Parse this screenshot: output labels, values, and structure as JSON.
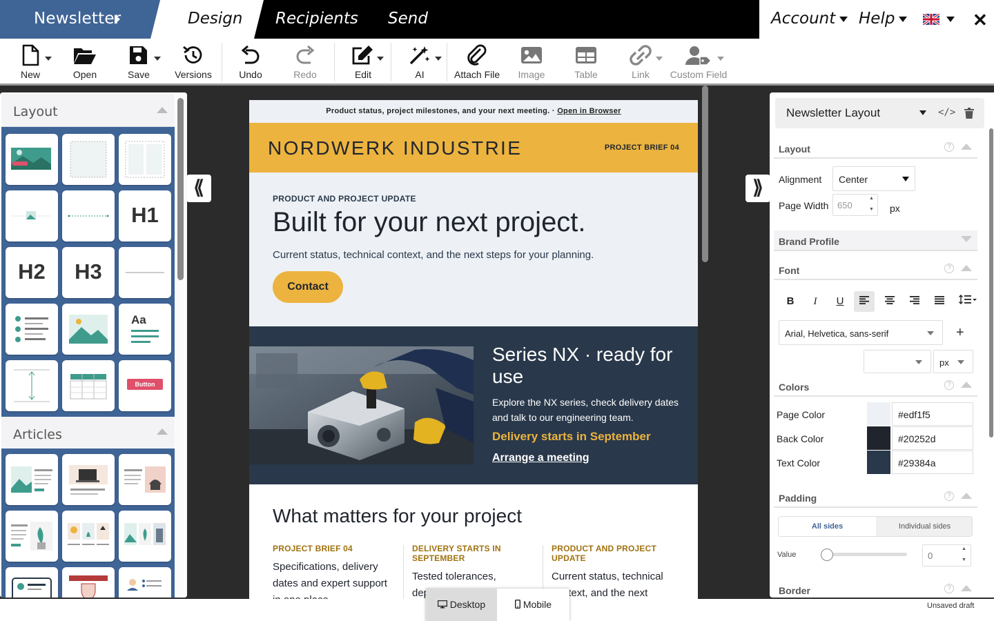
{
  "nav": {
    "brand": "Newsletter",
    "tabs": [
      "Design",
      "Recipients",
      "Send"
    ],
    "account": "Account",
    "help": "Help"
  },
  "toolbar": {
    "new": "New",
    "open": "Open",
    "save": "Save",
    "versions": "Versions",
    "undo": "Undo",
    "redo": "Redo",
    "edit": "Edit",
    "ai": "AI",
    "attach": "Attach File",
    "image": "Image",
    "table": "Table",
    "link": "Link",
    "custom_field": "Custom Field"
  },
  "left_panel": {
    "layout_title": "Layout",
    "articles_title": "Articles",
    "tiles": {
      "h1": "H1",
      "h2": "H2",
      "h3": "H3",
      "aa": "Aa",
      "button": "Button"
    }
  },
  "email": {
    "preheader": "Product status, project milestones, and your next meeting. · ",
    "preheader_link": "Open in Browser",
    "logo": "NORDWERK INDUSTRIE",
    "brief": "PROJECT BRIEF 04",
    "kicker": "PRODUCT AND PROJECT UPDATE",
    "title": "Built for your next project.",
    "subtitle": "Current status, technical context, and the next steps for your planning.",
    "cta": "Contact",
    "feature": {
      "title": "Series NX · ready for use",
      "desc": "Explore the NX series, check delivery dates and talk to our engineering team.",
      "highlight": "Delivery starts in September",
      "link": "Arrange a meeting"
    },
    "matters": {
      "title": "What matters for your project",
      "columns": [
        {
          "heading": "PROJECT BRIEF 04",
          "body": "Specifications, delivery dates and expert support in one place."
        },
        {
          "heading": "DELIVERY STARTS IN SEPTEMBER",
          "body": "Tested tolerances, dependable timelines."
        },
        {
          "heading": "PRODUCT AND PROJECT UPDATE",
          "body": "Current status, technical context, and the next"
        }
      ]
    }
  },
  "device": {
    "desktop": "Desktop",
    "mobile": "Mobile"
  },
  "right_panel": {
    "title": "Newsletter Layout",
    "layout_section": "Layout",
    "alignment_label": "Alignment",
    "alignment_value": "Center",
    "page_width_label": "Page Width",
    "page_width_placeholder": "650",
    "unit_px": "px",
    "brand_profile": "Brand Profile",
    "font_section": "Font",
    "font_family": "Arial, Helvetica, sans-serif",
    "font_unit": "px",
    "colors_section": "Colors",
    "colors": [
      {
        "label": "Page Color",
        "hex": "#edf1f5"
      },
      {
        "label": "Back Color",
        "hex": "#20252d"
      },
      {
        "label": "Text Color",
        "hex": "#29384a"
      }
    ],
    "padding_section": "Padding",
    "all_sides": "All sides",
    "individual_sides": "Individual sides",
    "value_label": "Value",
    "value": "0",
    "border_section": "Border"
  },
  "status": "Unsaved draft",
  "theme": {
    "nav_blue": "#3f6496",
    "accent": "#ecb33f",
    "dark": "#29384a"
  }
}
